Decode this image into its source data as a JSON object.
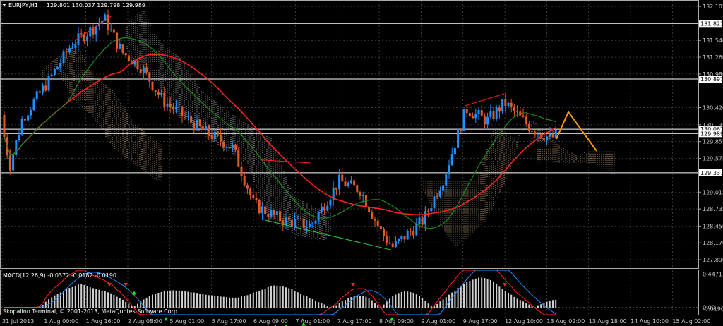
{
  "window": {
    "symbol_timeframe": "EURJPY,H1",
    "ohlc": "129.801 130.037 129.798 129.989",
    "menu_icon": "triangle-down-icon"
  },
  "colors": {
    "background": "#000000",
    "grid": "#5a5a5a",
    "bull_candle": "#1e90ff",
    "bear_candle": "#e05a28",
    "ma_fast": "#ff2020",
    "ma_slow": "#1a8a1a",
    "cloud_bull": "#ffd0a0",
    "cloud_bear": "#e0e0e0",
    "projection": "#ff9900",
    "macd_line": "#ff2020",
    "signal_line": "#1e90ff",
    "up_arrow": "#00ff00",
    "down_arrow": "#ff2020"
  },
  "chart_data": [
    {
      "type": "candlestick",
      "ylim": [
        127.75,
        132.2
      ],
      "y_ticks": [
        "132.105",
        "131.540",
        "131.260",
        "130.980",
        "130.420",
        "130.135",
        "129.855",
        "129.575",
        "129.015",
        "128.735",
        "128.450",
        "128.170",
        "127.890"
      ],
      "x_ticks": [
        "31 Jul 2013",
        "1 Aug 00:00",
        "1 Aug 16:00",
        "2 Aug 08:00",
        "5 Aug 01:00",
        "5 Aug 17:00",
        "6 Aug 09:00",
        "7 Aug 01:00",
        "7 Aug 17:00",
        "8 Aug 09:00",
        "9 Aug 01:00",
        "9 Aug 17:00",
        "12 Aug 10:00",
        "13 Aug 02:00",
        "13 Aug 18:00",
        "14 Aug 10:00",
        "15 Aug 02:00"
      ],
      "horizontal_levels": [
        {
          "value": 131.821,
          "label": "131.821"
        },
        {
          "value": 130.897,
          "label": "130.897"
        },
        {
          "value": 130.062,
          "label": "130.062"
        },
        {
          "value": 129.989,
          "label": "129.989"
        },
        {
          "value": 129.337,
          "label": "129.337"
        }
      ],
      "current_price": 129.989
    },
    {
      "type": "line",
      "title": "MACD(12,26,9) -0.0372 -0.0182 -0.0190",
      "ylim": [
        -0.1,
        0.5
      ],
      "y_ticks": [
        "0.4471",
        "0.00",
        "-0.0190"
      ]
    }
  ],
  "footer": {
    "copyright": "Skopalino Terminal, © 2001-2013, MetaQuotes Software Corp."
  }
}
